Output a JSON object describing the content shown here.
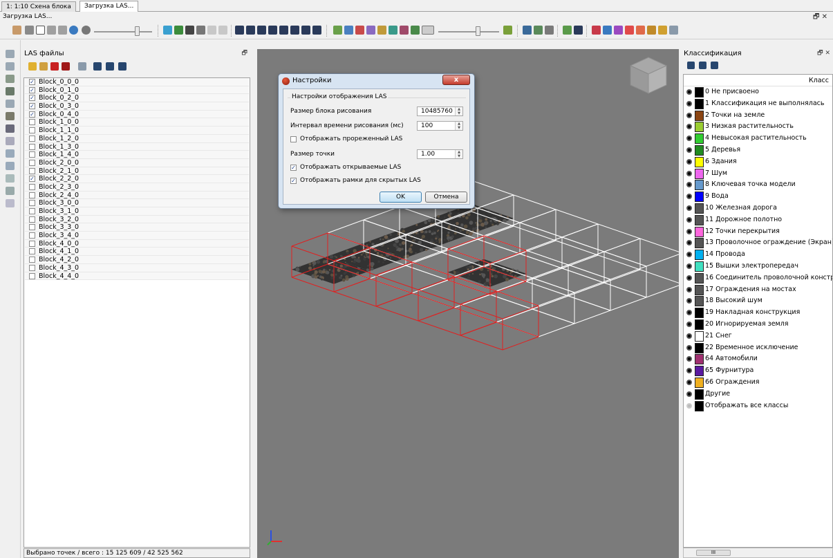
{
  "tabs": [
    {
      "label": "1: 1:10 Схена блока",
      "active": false
    },
    {
      "label": "Загрузка LAS...",
      "active": true
    }
  ],
  "window_title": "Загрузка LAS...",
  "window_controls": "🗗 ✕",
  "las_panel": {
    "title": "LAS файлы",
    "dock_icon": "🗗",
    "files": [
      {
        "name": "Block_0_0_0",
        "checked": true
      },
      {
        "name": "Block_0_1_0",
        "checked": true
      },
      {
        "name": "Block_0_2_0",
        "checked": true
      },
      {
        "name": "Block_0_3_0",
        "checked": true
      },
      {
        "name": "Block_0_4_0",
        "checked": true
      },
      {
        "name": "Block_1_0_0",
        "checked": false
      },
      {
        "name": "Block_1_1_0",
        "checked": false
      },
      {
        "name": "Block_1_2_0",
        "checked": false
      },
      {
        "name": "Block_1_3_0",
        "checked": false
      },
      {
        "name": "Block_1_4_0",
        "checked": false
      },
      {
        "name": "Block_2_0_0",
        "checked": false
      },
      {
        "name": "Block_2_1_0",
        "checked": false
      },
      {
        "name": "Block_2_2_0",
        "checked": true
      },
      {
        "name": "Block_2_3_0",
        "checked": false
      },
      {
        "name": "Block_2_4_0",
        "checked": false
      },
      {
        "name": "Block_3_0_0",
        "checked": false
      },
      {
        "name": "Block_3_1_0",
        "checked": false
      },
      {
        "name": "Block_3_2_0",
        "checked": false
      },
      {
        "name": "Block_3_3_0",
        "checked": false
      },
      {
        "name": "Block_3_4_0",
        "checked": false
      },
      {
        "name": "Block_4_0_0",
        "checked": false
      },
      {
        "name": "Block_4_1_0",
        "checked": false
      },
      {
        "name": "Block_4_2_0",
        "checked": false
      },
      {
        "name": "Block_4_3_0",
        "checked": false
      },
      {
        "name": "Block_4_4_0",
        "checked": false
      }
    ],
    "status": "Выбрано точек / всего : 15 125 609 / 42 525 562"
  },
  "dialog": {
    "title": "Настройки",
    "close_label": "x",
    "group_label": "Настройки отображения LAS",
    "block_size_label": "Размер блока рисования",
    "block_size_value": "10485760",
    "interval_label": "Интервал времени рисования (мс)",
    "interval_value": "100",
    "show_thinned_label": "Отображать прореженный LAS",
    "show_thinned": false,
    "point_size_label": "Размер точки",
    "point_size_value": "1.00",
    "show_opened_label": "Отображать открываемые LAS",
    "show_opened": true,
    "show_frames_label": "Отображать рамки для скрытых LAS",
    "show_frames": true,
    "ok_label": "OK",
    "cancel_label": "Отмена"
  },
  "classification": {
    "title": "Классификация",
    "dock_icon": "🗗 ✕",
    "column_header": "Класс",
    "classes": [
      {
        "label": "0 Не присвоено",
        "color": "#000000"
      },
      {
        "label": "1 Классификация не выполнялась",
        "color": "#000000"
      },
      {
        "label": "2 Точки на земле",
        "color": "#8b4513"
      },
      {
        "label": "3 Низкая растительность",
        "color": "#9acd32"
      },
      {
        "label": "4 Невысокая растительность",
        "color": "#32cd32"
      },
      {
        "label": "5 Деревья",
        "color": "#228b22"
      },
      {
        "label": "6 Здания",
        "color": "#ffff00"
      },
      {
        "label": "7 Шум",
        "color": "#ee66ee"
      },
      {
        "label": "8 Ключевая точка модели",
        "color": "#6699cc"
      },
      {
        "label": "9 Вода",
        "color": "#0000ff"
      },
      {
        "label": "10 Железная дорога",
        "color": "#555555"
      },
      {
        "label": "11 Дорожное полотно",
        "color": "#555555"
      },
      {
        "label": "12 Точки перекрытия",
        "color": "#ff66dd"
      },
      {
        "label": "13 Проволочное ограждение (Экран)",
        "color": "#555555"
      },
      {
        "label": "14 Провода",
        "color": "#00b0f0"
      },
      {
        "label": "15 Вышки электропередач",
        "color": "#40e0c0"
      },
      {
        "label": "16 Соединитель проволочной констру",
        "color": "#555555"
      },
      {
        "label": "17 Ограждения на мостах",
        "color": "#555555"
      },
      {
        "label": "18 Высокий шум",
        "color": "#555555"
      },
      {
        "label": "19 Накладная конструкция",
        "color": "#000000"
      },
      {
        "label": "20 Игнорируемая земля",
        "color": "#000000"
      },
      {
        "label": "21 Снег",
        "color": "#ffffff"
      },
      {
        "label": "22 Временное исключение",
        "color": "#000000"
      },
      {
        "label": "64 Автомобили",
        "color": "#a03070"
      },
      {
        "label": "65 Фурнитура",
        "color": "#5a1aa0"
      },
      {
        "label": "66 Ограждения",
        "color": "#f0b020"
      },
      {
        "label": "Другие",
        "color": "#000000"
      },
      {
        "label": "Отображать все классы",
        "color": "#000000"
      }
    ],
    "scroll_thumb_label": "III"
  },
  "colors": {
    "viewport_bg": "#7b7b7b",
    "selected_frame": "#e02020",
    "unselected_frame": "#ffffff"
  }
}
